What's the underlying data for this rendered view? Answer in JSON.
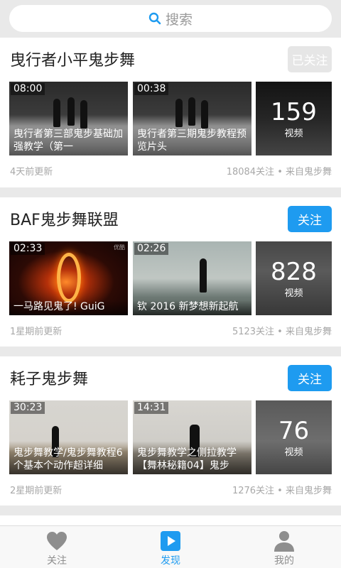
{
  "search": {
    "placeholder": "搜索"
  },
  "cards": [
    {
      "title": "曳行者小平鬼步舞",
      "follow_label": "已关注",
      "videos": [
        {
          "duration": "08:00",
          "caption": "曳行者第三部鬼步基础加强教学（第一"
        },
        {
          "duration": "00:38",
          "caption": "曳行者第三期鬼步教程预览片头"
        }
      ],
      "count": "159",
      "count_label": "视频",
      "updated": "4天前更新",
      "meta": "18084关注 • 来自鬼步舞"
    },
    {
      "title": "BAF鬼步舞联盟",
      "follow_label": "关注",
      "videos": [
        {
          "duration": "02:33",
          "caption": "一马路见鬼了! GuiG"
        },
        {
          "duration": "02:26",
          "caption": "钦  2016  新梦想新起航"
        }
      ],
      "count": "828",
      "count_label": "视频",
      "updated": "1星期前更新",
      "meta": "5123关注 • 来自鬼步舞"
    },
    {
      "title": "耗子鬼步舞",
      "follow_label": "关注",
      "videos": [
        {
          "duration": "30:23",
          "caption": "鬼步舞教学/鬼步舞教程6个基本个动作超详细"
        },
        {
          "duration": "14:31",
          "caption": "鬼步舞教学之侧拉教学【舞林秘籍04】鬼步"
        }
      ],
      "count": "76",
      "count_label": "视频",
      "updated": "2星期前更新",
      "meta": "1276关注 • 来自鬼步舞"
    }
  ],
  "tabs": [
    {
      "label": "关注",
      "icon": "heart-icon"
    },
    {
      "label": "发现",
      "icon": "play-icon"
    },
    {
      "label": "我的",
      "icon": "person-icon"
    }
  ],
  "colors": {
    "accent": "#1e9bf0",
    "followed": "#e6e6e6"
  }
}
